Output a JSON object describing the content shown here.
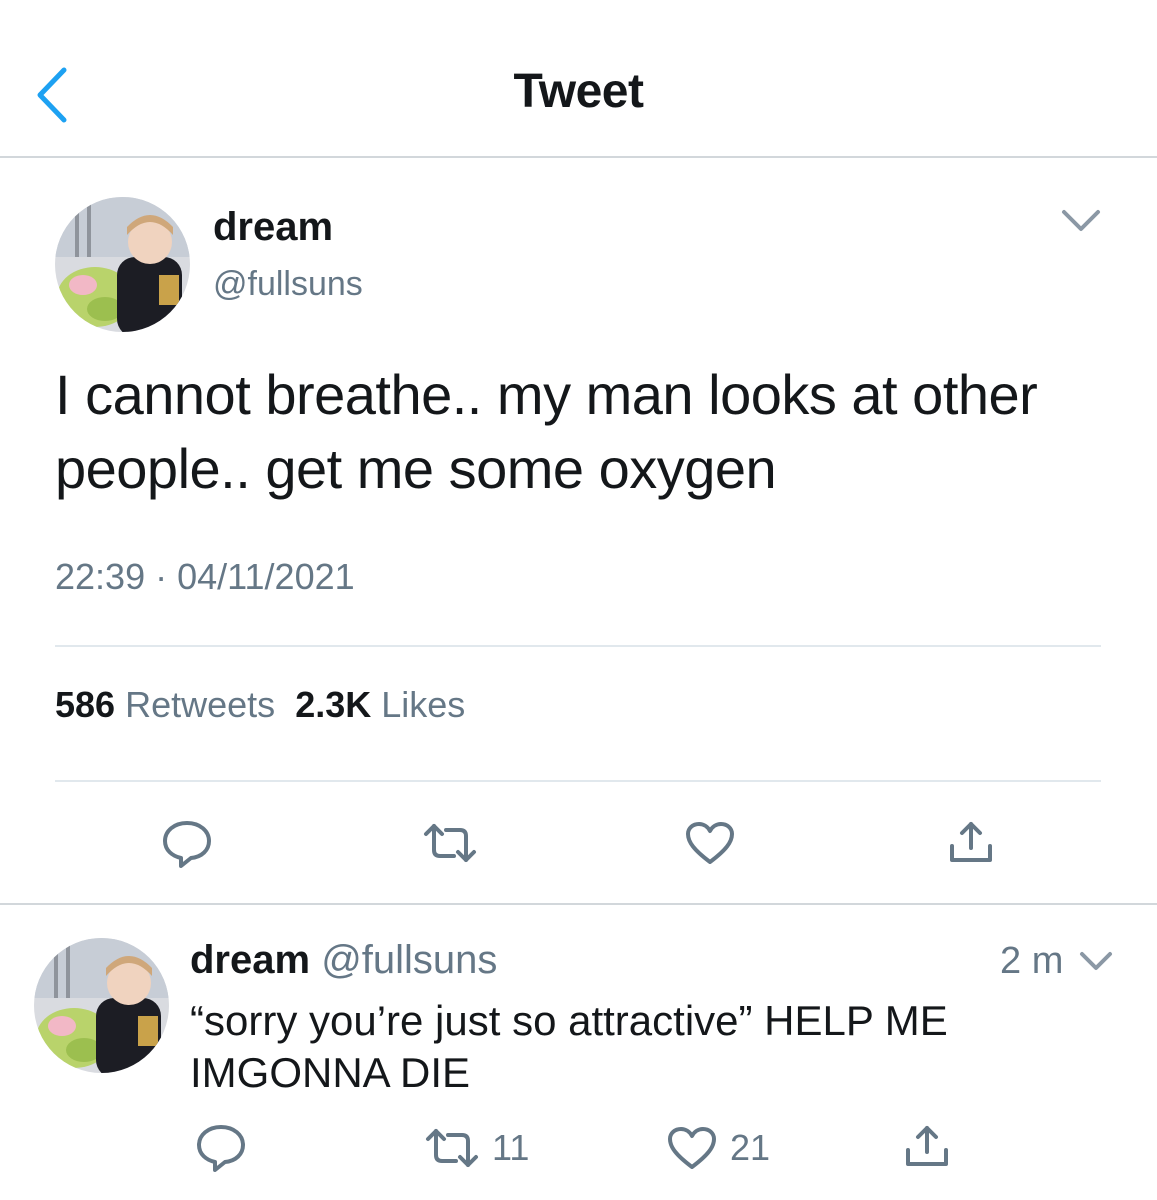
{
  "header": {
    "title": "Tweet",
    "back_icon": "chevron-left-icon",
    "accent": "#1da1f2"
  },
  "main_tweet": {
    "display_name": "dream",
    "handle": "@fullsuns",
    "text": "I cannot breathe.. my man looks at other people.. get me some oxygen",
    "time": "22:39",
    "separator": "·",
    "date": "04/11/2021",
    "retweet_count": "586",
    "retweet_label": "Retweets",
    "like_count": "2.3K",
    "like_label": "Likes"
  },
  "reply": {
    "display_name": "dream",
    "handle": "@fullsuns",
    "time": "2 m",
    "text": "“sorry you’re just so attractive” HELP ME IMGONNA DIE",
    "retweet_count": "11",
    "like_count": "21"
  },
  "colors": {
    "text": "#14171a",
    "secondary": "#657786",
    "divider": "#e1e8ed"
  }
}
